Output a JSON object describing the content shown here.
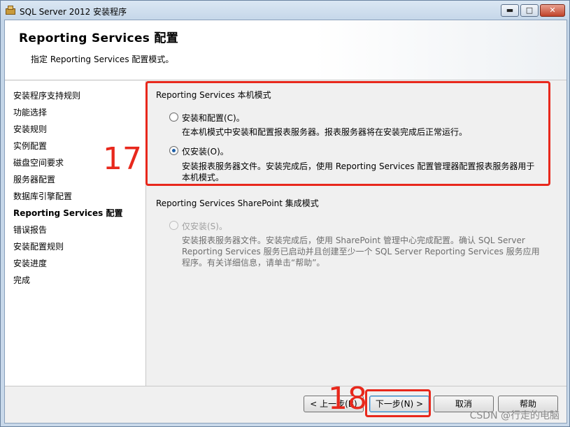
{
  "window": {
    "title": "SQL Server 2012 安装程序",
    "controls": {
      "minimize": "▬",
      "maximize": "□",
      "close": "✕"
    }
  },
  "header": {
    "title": "Reporting  Services 配置",
    "subtitle": "指定 Reporting Services 配置模式。"
  },
  "nav": {
    "items": [
      {
        "label": "安装程序支持规则",
        "active": false
      },
      {
        "label": "功能选择",
        "active": false
      },
      {
        "label": "安装规则",
        "active": false
      },
      {
        "label": "实例配置",
        "active": false
      },
      {
        "label": "磁盘空间要求",
        "active": false
      },
      {
        "label": "服务器配置",
        "active": false
      },
      {
        "label": "数据库引擎配置",
        "active": false
      },
      {
        "label": "Reporting Services 配置",
        "active": true
      },
      {
        "label": "错误报告",
        "active": false
      },
      {
        "label": "安装配置规则",
        "active": false
      },
      {
        "label": "安装进度",
        "active": false
      },
      {
        "label": "完成",
        "active": false
      }
    ]
  },
  "native_mode": {
    "group_label": "Reporting Services 本机模式",
    "option1": {
      "label": "安装和配置(C)。",
      "description": "在本机模式中安装和配置报表服务器。报表服务器将在安装完成后正常运行。",
      "selected": false
    },
    "option2": {
      "label": "仅安装(O)。",
      "description_line1": "安装报表服务器文件。安装完成后，使用 Reporting Services 配置管理器配置报表服务器用于",
      "description_line2": "本机模式。",
      "selected": true
    }
  },
  "sharepoint_mode": {
    "group_label": "Reporting Services SharePoint 集成模式",
    "option": {
      "label": "仅安装(S)。",
      "description_line1": "安装报表服务器文件。安装完成后，使用 SharePoint 管理中心完成配置。确认 SQL Server",
      "description_line2": "Reporting Services 服务已启动并且创建至少一个 SQL Server Reporting Services 服务应用",
      "description_line3": "程序。有关详细信息，请单击“帮助”。",
      "enabled": false
    }
  },
  "annotations": {
    "step17": "17",
    "step18": "18"
  },
  "footer": {
    "back": "< 上一步(B)",
    "next": "下一步(N) >",
    "cancel": "取消",
    "help": "帮助"
  },
  "watermark": "CSDN @行走的电脑",
  "colors": {
    "annotation_red": "#e8281c",
    "radio_dot": "#1d5fa8"
  }
}
